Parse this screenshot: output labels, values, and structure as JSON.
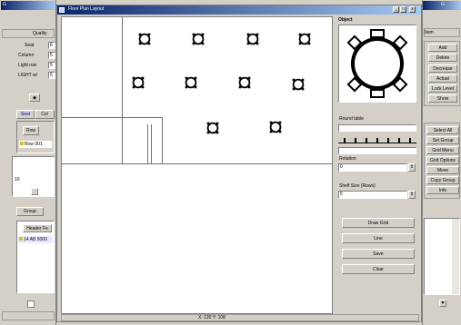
{
  "main_window": {
    "title": "Floor Plan Layout",
    "status": "X: 120  Y: 108",
    "controls": {
      "minimize": "_",
      "maximize": "□",
      "close": "x"
    }
  },
  "left_panel": {
    "title": "G",
    "header_label": "Quality",
    "fields": [
      {
        "label": "Seat",
        "value": "6"
      },
      {
        "label": "Column",
        "value": "5"
      },
      {
        "label": "Light row",
        "value": "5"
      },
      {
        "label": "LIGHT w/",
        "value": "5"
      }
    ],
    "tabs": [
      "Seat",
      "Col"
    ],
    "list_header": [
      "Row"
    ],
    "list_rows": [
      "Row 001"
    ],
    "side_number": "10",
    "group_button": "Group",
    "lower_header": "Header Fe",
    "lower_rows": [
      "14 AB 5000"
    ]
  },
  "object_panel": {
    "title": "Object",
    "table_label": "Round table",
    "ruler_ticks": [
      "",
      "",
      "",
      "",
      "",
      "",
      ""
    ],
    "rotation_label": "Rotation",
    "rotation_value": "0",
    "shelf_label": "Shelf Size (Rows)",
    "shelf_value": "5",
    "buttons": [
      "Draw Grid",
      "Line",
      "Save",
      "Clear"
    ]
  },
  "right_panel": {
    "title": "G",
    "header_label": "Item",
    "buttons_top": [
      "Add",
      "Delete",
      "Decrease",
      "Actual",
      "Lock Level",
      "Show"
    ],
    "buttons_lower": [
      "Select All",
      "Set Group",
      "Grid Menu",
      "Grid Options",
      "Move",
      "Copy Group",
      "Info"
    ]
  },
  "tables_row1": [
    "t1",
    "t2",
    "t3",
    "t4"
  ],
  "tables_row2": [
    "t5",
    "t6",
    "t7",
    "t8"
  ],
  "tables_row3": [
    "t9",
    "t10"
  ]
}
